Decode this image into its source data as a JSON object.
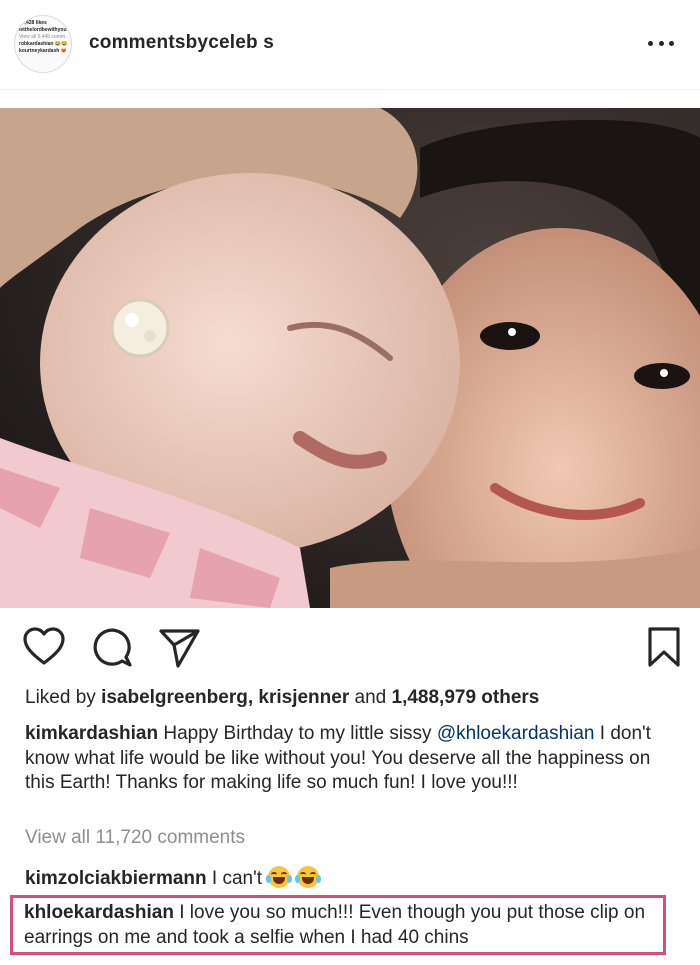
{
  "header": {
    "username": "commentsbyceleb s",
    "avatar_lines": [
      "15,428 likes",
      "letthelordbewithyou",
      "View all 5,445 comm",
      "robkardashian 😂😂",
      "kourtneykardash 😻"
    ]
  },
  "post": {
    "likes_prefix": "Liked by",
    "likes_users": "isabelgreenberg, krisjenner",
    "likes_and": "and",
    "likes_count": "1,488,979 others",
    "caption_user": "kimkardashian",
    "caption_text_1": "Happy Birthday to my little sissy",
    "caption_mention": "@khloekardashian",
    "caption_text_2": "I don't know what life would be like without you! You deserve all the happiness on this Earth! Thanks for making life so much fun! I love you!!!",
    "view_all": "View all 11,720 comments"
  },
  "comments": [
    {
      "user": "kimzolciakbiermann",
      "text": "I can't"
    },
    {
      "user": "khloekardashian",
      "text": "I love you so much!!! Even though you put those clip on earrings on me and took a selfie when I had 40 chins"
    }
  ],
  "icons": {
    "heart": "heart-icon",
    "comment": "comment-icon",
    "share": "share-icon",
    "bookmark": "bookmark-icon",
    "more": "more-icon"
  },
  "colors": {
    "text": "#262626",
    "muted": "#8e8e8e",
    "mention": "#003569",
    "highlight_border": "#d84e7a"
  }
}
